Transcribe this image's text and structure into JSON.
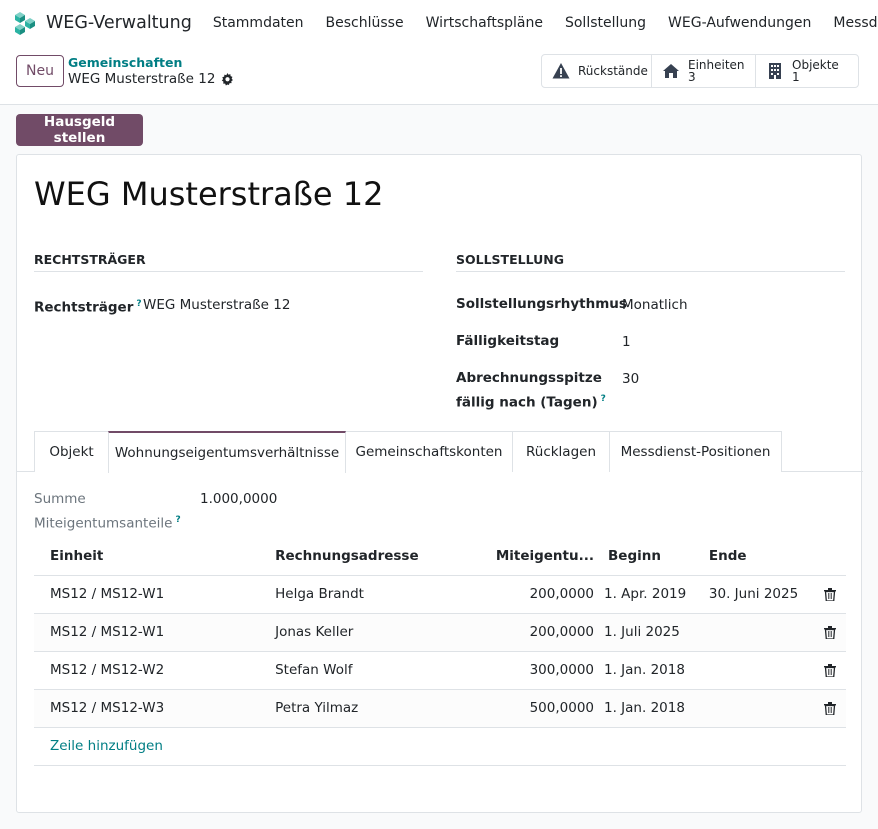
{
  "app": {
    "title": "WEG-Verwaltung"
  },
  "menu": [
    "Stammdaten",
    "Beschlüsse",
    "Wirtschaftspläne",
    "Sollstellung",
    "WEG-Aufwendungen",
    "Messdienstabrechnung"
  ],
  "control": {
    "new_label": "Neu",
    "breadcrumb_parent": "Gemeinschaften",
    "breadcrumb_current": "WEG Musterstraße 12",
    "smart_buttons": {
      "rueckstaende": "Rückstände",
      "einheiten_label": "Einheiten",
      "einheiten_count": "3",
      "objekte_label": "Objekte",
      "objekte_count": "1"
    },
    "primary_action": "Hausgeld stellen"
  },
  "record": {
    "title": "WEG Musterstraße 12",
    "section_left": "RECHTSTRÄGER",
    "section_right": "SOLLSTELLUNG",
    "rechtstraeger_label": "Rechtsträger",
    "rechtstraeger_value": "WEG Musterstraße 12",
    "rhythmus_label": "Sollstellungsrhythmus",
    "rhythmus_value": "Monatlich",
    "faellig_label": "Fälligkeitstag",
    "faellig_value": "1",
    "spitze_label_1": "Abrechnungsspitze",
    "spitze_label_2": "fällig nach (Tagen)",
    "spitze_value": "30"
  },
  "tabs": [
    "Objekt",
    "Wohnungseigentumsverhältnisse",
    "Gemeinschaftskonten",
    "Rücklagen",
    "Messdienst-Positionen"
  ],
  "summary": {
    "label_1": "Summe",
    "label_2": "Miteigentumsanteile",
    "value": "1.000,0000"
  },
  "table": {
    "headers": [
      "Einheit",
      "Rechnungsadresse",
      "Miteigentu...",
      "Beginn",
      "Ende"
    ],
    "rows": [
      {
        "einheit": "MS12 / MS12-W1",
        "adresse": "Helga Brandt",
        "anteil": "200,0000",
        "beginn": "1. Apr. 2019",
        "ende": "30. Juni 2025"
      },
      {
        "einheit": "MS12 / MS12-W1",
        "adresse": "Jonas Keller",
        "anteil": "200,0000",
        "beginn": "1. Juli 2025",
        "ende": ""
      },
      {
        "einheit": "MS12 / MS12-W2",
        "adresse": "Stefan Wolf",
        "anteil": "300,0000",
        "beginn": "1. Jan. 2018",
        "ende": ""
      },
      {
        "einheit": "MS12 / MS12-W3",
        "adresse": "Petra Yilmaz",
        "anteil": "500,0000",
        "beginn": "1. Jan. 2018",
        "ende": ""
      }
    ],
    "add_line": "Zeile hinzufügen"
  },
  "icons": {
    "brand": "cube-logo-icon",
    "warning": "warning-icon",
    "home": "home-icon",
    "building": "building-icon",
    "gear": "gear-icon",
    "trash": "trash-icon"
  },
  "colors": {
    "primary": "#714b67",
    "link": "#017e84"
  }
}
